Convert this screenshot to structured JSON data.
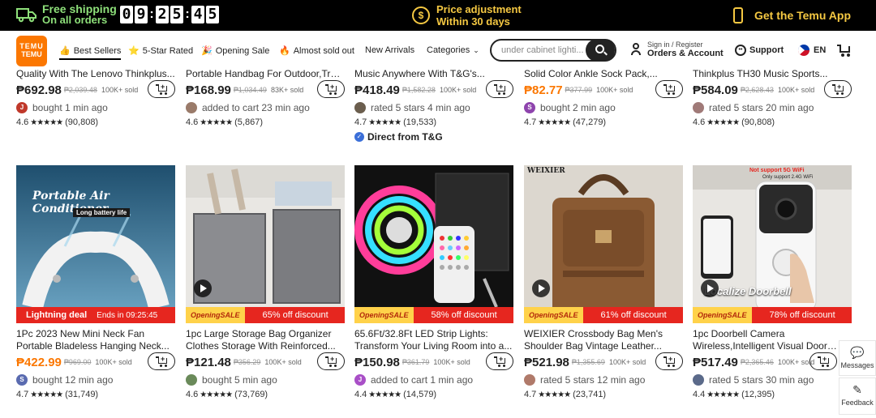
{
  "promo": {
    "shipping_line1": "Free shipping",
    "shipping_line2": "On all orders",
    "timer": [
      "0",
      "9",
      ":",
      "2",
      "5",
      ":",
      "4",
      "5"
    ],
    "price_adj_line1": "Price adjustment",
    "price_adj_line2": "Within 30 days",
    "app_label": "Get the Temu App"
  },
  "nav": {
    "logo_line1": "TEMU",
    "logo_line2": "TEMU",
    "best_sellers": "Best Sellers",
    "five_star": "5-Star Rated",
    "opening_sale": "Opening Sale",
    "almost_sold_out": "Almost sold out",
    "new_arrivals": "New Arrivals",
    "categories": "Categories",
    "search_placeholder": "under cabinet lighti...",
    "signin": "Sign in / Register",
    "orders": "Orders & Account",
    "support": "Support",
    "lang": "EN"
  },
  "top_row": [
    {
      "title": "Quality With The Lenovo Thinkplus...",
      "price": "₱692.98",
      "orange": false,
      "old": "₱2,039.48",
      "sold": "100K+ sold",
      "avatar": "J",
      "avatar_color": "#c0392b",
      "activity": "bought 1 min ago",
      "rating": "4.6",
      "stars": "★★★★★",
      "count": "(90,808)",
      "tg": ""
    },
    {
      "title": "Portable Handbag For Outdoor,Trav...",
      "price": "₱168.99",
      "orange": false,
      "old": "₱1,034.49",
      "sold": "83K+ sold",
      "avatar": "",
      "avatar_color": "#9a7b6a",
      "activity": "added to cart 23 min ago",
      "rating": "4.6",
      "stars": "★★★★★",
      "count": "(5,867)",
      "tg": ""
    },
    {
      "title": "Music Anywhere With T&G's...",
      "price": "₱418.49",
      "orange": false,
      "old": "₱1,582.28",
      "sold": "100K+ sold",
      "avatar": "",
      "avatar_color": "#6b5e4e",
      "activity": "rated 5 stars 4 min ago",
      "rating": "4.7",
      "stars": "★★★★★",
      "count": "(19,533)",
      "tg": "Direct from T&G"
    },
    {
      "title": "Solid Color Ankle Sock Pack,...",
      "price": "₱82.77",
      "orange": true,
      "old": "₱377.99",
      "sold": "100K+ sold",
      "avatar": "S",
      "avatar_color": "#8e44ad",
      "activity": "bought 2 min ago",
      "rating": "4.7",
      "stars": "★★★★★",
      "count": "(47,279)",
      "tg": ""
    },
    {
      "title": "Thinkplus TH30 Music Sports...",
      "price": "₱584.09",
      "orange": false,
      "old": "₱2,628.43",
      "sold": "100K+ sold",
      "avatar": "",
      "avatar_color": "#a07a78",
      "activity": "rated 5 stars 20 min ago",
      "rating": "4.6",
      "stars": "★★★★★",
      "count": "(90,808)",
      "tg": ""
    }
  ],
  "products": [
    {
      "img_text": "Portable Air Conditioner",
      "img_sub": "Long battery life",
      "band_type": "lightning",
      "band_light": "Lightning deal",
      "band_text": "Ends in 09:25:45",
      "opening1": "",
      "opening2": "",
      "title1": "1Pc 2023 New Mini Neck Fan",
      "title2": "Portable Bladeless Hanging Neck...",
      "price": "₱422.99",
      "orange": true,
      "old": "₱969.00",
      "sold": "100K+ sold",
      "avatar": "S",
      "avatar_color": "#5a6bb0",
      "activity": "bought 12 min ago",
      "rating": "4.7",
      "stars": "★★★★★",
      "count": "(31,749)"
    },
    {
      "img_text": "",
      "img_sub": "",
      "band_type": "opening",
      "band_light": "",
      "band_text": "65% off discount",
      "opening1": "Opening",
      "opening2": "SALE",
      "title1": "1pc Large Storage Bag Organizer",
      "title2": "Clothes Storage With Reinforced...",
      "price": "₱121.48",
      "orange": false,
      "old": "₱356.29",
      "sold": "100K+ sold",
      "avatar": "",
      "avatar_color": "#6a8a5a",
      "activity": "bought 5 min ago",
      "rating": "4.6",
      "stars": "★★★★★",
      "count": "(73,769)"
    },
    {
      "img_text": "",
      "img_sub": "",
      "band_type": "opening",
      "band_light": "",
      "band_text": "58% off discount",
      "opening1": "Opening",
      "opening2": "SALE",
      "title1": "65.6Ft/32.8Ft LED Strip Lights:",
      "title2": "Transform Your Living Room into a...",
      "price": "₱150.98",
      "orange": false,
      "old": "₱361.79",
      "sold": "100K+ sold",
      "avatar": "J",
      "avatar_color": "#a94fc7",
      "activity": "added to cart 1 min ago",
      "rating": "4.4",
      "stars": "★★★★★",
      "count": "(14,579)"
    },
    {
      "img_text": "WEIXIER",
      "img_sub": "",
      "band_type": "opening",
      "band_light": "",
      "band_text": "61% off discount",
      "opening1": "Opening",
      "opening2": "SALE",
      "title1": "WEIXIER Crossbody Bag Men's",
      "title2": "Shoulder Bag Vintage Leather...",
      "price": "₱521.98",
      "orange": false,
      "old": "₱1,355.69",
      "sold": "100K+ sold",
      "avatar": "",
      "avatar_color": "#b07a6a",
      "activity": "rated 5 stars 12 min ago",
      "rating": "4.7",
      "stars": "★★★★★",
      "count": "(23,741)"
    },
    {
      "img_text": "Not support 5G WiFi",
      "img_sub": "Only support 2.4G WiFi",
      "band_type": "opening",
      "band_light": "",
      "band_text": "78% off discount",
      "opening1": "Opening",
      "opening2": "SALE",
      "title1": "1pc Doorbell Camera",
      "title2": "Wireless,Intelligent Visual Doorbell...",
      "price": "₱517.49",
      "orange": false,
      "old": "₱2,365.46",
      "sold": "100K+ sold",
      "avatar": "",
      "avatar_color": "#5b6a8a",
      "activity": "rated 5 stars 30 min ago",
      "rating": "4.4",
      "stars": "★★★★★",
      "count": "(12,395)"
    }
  ],
  "doorbell_overlay": "Localize Doorbell",
  "side": {
    "messages": "Messages",
    "feedback": "Feedback"
  }
}
